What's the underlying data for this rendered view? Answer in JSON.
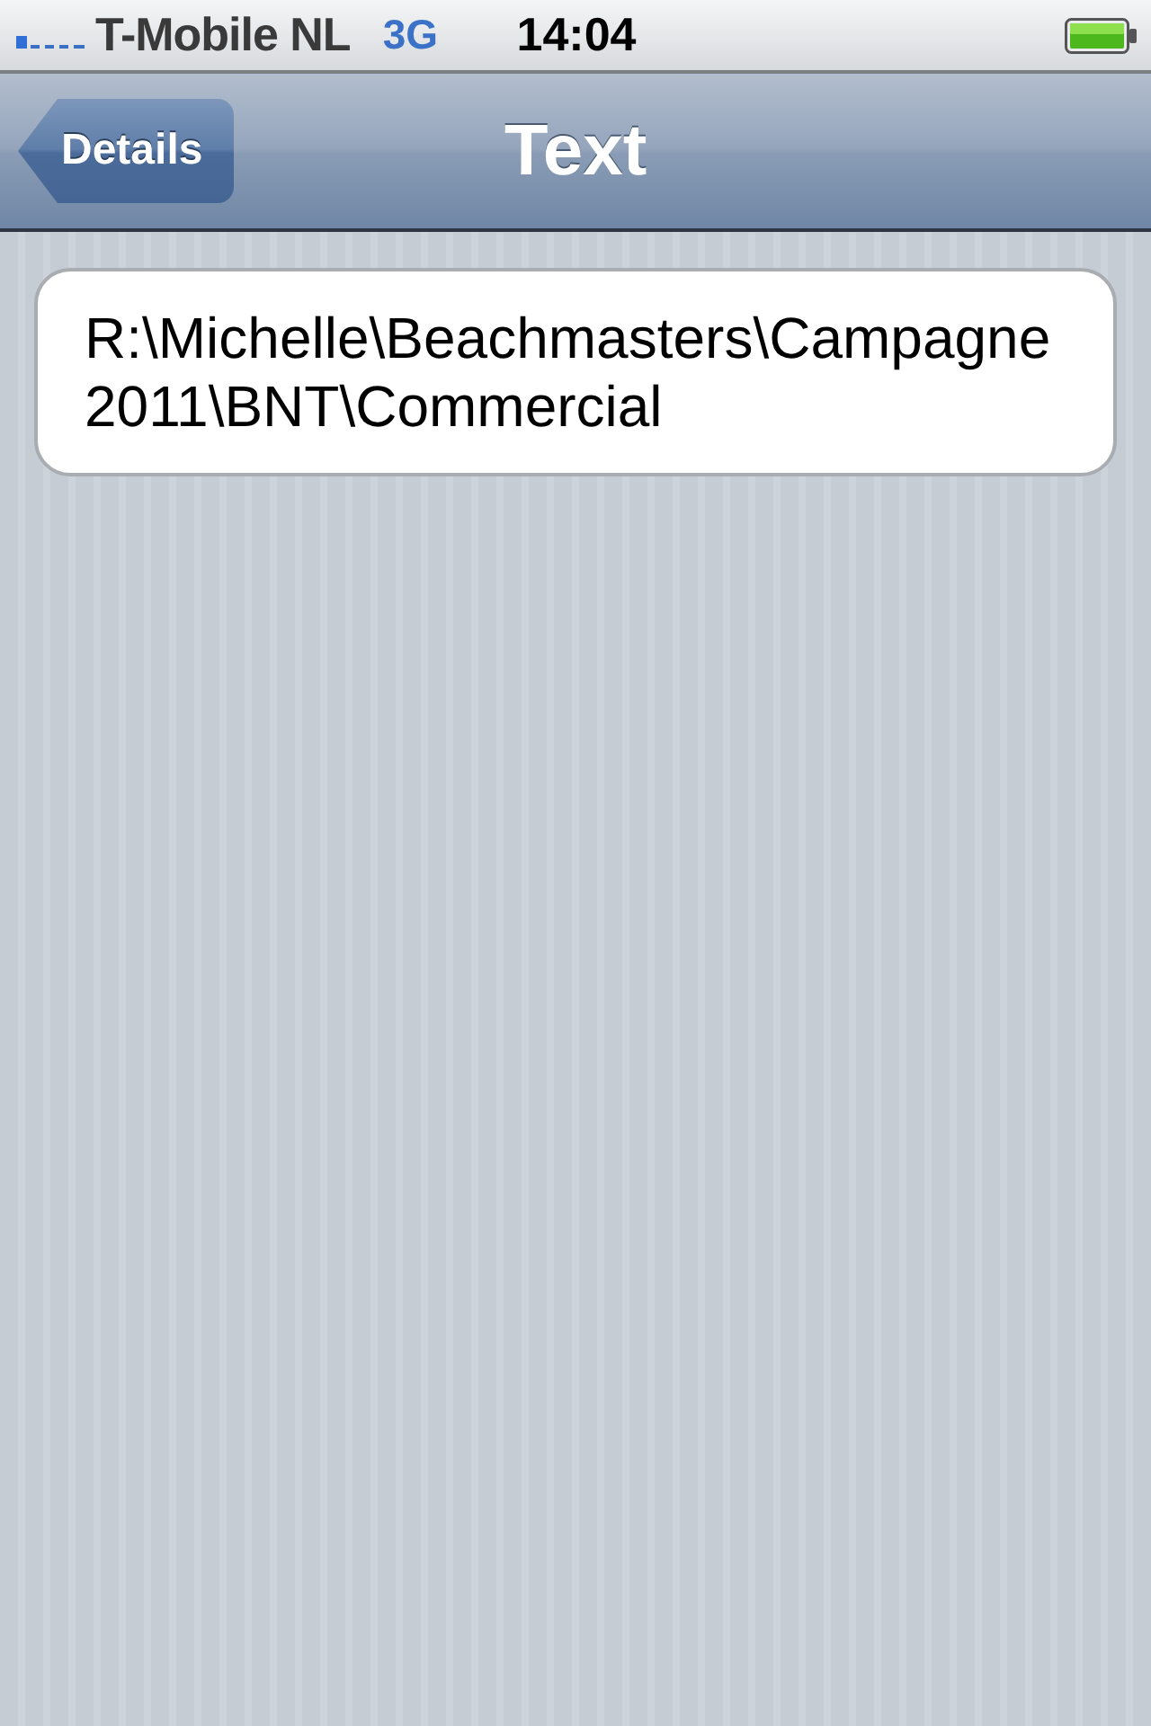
{
  "status_bar": {
    "carrier": "T-Mobile NL",
    "network": "3G",
    "time": "14:04"
  },
  "nav_bar": {
    "back_button": "Details",
    "title": "Text"
  },
  "text_view": {
    "value": "R:\\Michelle\\Beachmasters\\Campagne 2011\\BNT\\Commercial"
  }
}
